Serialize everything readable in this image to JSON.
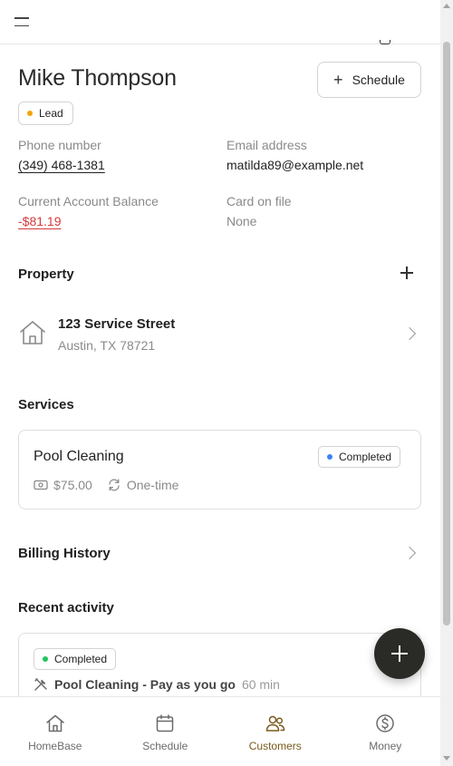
{
  "customer": {
    "name": "Mike Thompson",
    "status": {
      "label": "Lead",
      "color": "#f0a500"
    }
  },
  "actions": {
    "schedule_label": "Schedule",
    "schedule_icon": "plus-icon"
  },
  "contact": {
    "phone_label": "Phone number",
    "phone_value": "(349) 468-1381",
    "email_label": "Email address",
    "email_value": "matilda89@example.net",
    "balance_label": "Current Account Balance",
    "balance_value": "-$81.19",
    "card_label": "Card on file",
    "card_value": "None"
  },
  "property": {
    "section_title": "Property",
    "add_icon": "plus-icon",
    "street": "123 Service Street",
    "city": "Austin, TX 78721"
  },
  "services": {
    "section_title": "Services",
    "items": [
      {
        "name": "Pool Cleaning",
        "status": "Completed",
        "status_color": "#3b82f6",
        "price": "$75.00",
        "frequency": "One-time"
      }
    ]
  },
  "billing": {
    "section_title": "Billing History"
  },
  "activity": {
    "section_title": "Recent activity",
    "items": [
      {
        "status": "Completed",
        "status_color": "#22c55e",
        "title": "Pool Cleaning - Pay as you go",
        "duration": "60 min"
      }
    ]
  },
  "colors": {
    "accent": "#7a5a1c",
    "negative": "#d63b3b",
    "fab": "#2a2a27"
  },
  "nav": {
    "items": [
      {
        "label": "HomeBase",
        "icon": "home-icon",
        "active": false
      },
      {
        "label": "Schedule",
        "icon": "calendar-icon",
        "active": false
      },
      {
        "label": "Customers",
        "icon": "users-icon",
        "active": true
      },
      {
        "label": "Money",
        "icon": "dollar-icon",
        "active": false
      }
    ]
  }
}
